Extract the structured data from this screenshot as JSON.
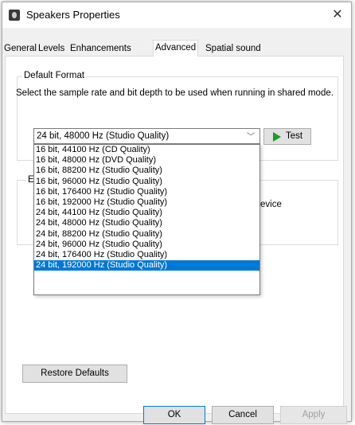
{
  "window": {
    "title": "Speakers Properties",
    "close_glyph": "✕"
  },
  "tabs": [
    {
      "label": "General"
    },
    {
      "label": "Levels"
    },
    {
      "label": "Enhancements"
    },
    {
      "label": "Advanced"
    },
    {
      "label": "Spatial sound"
    }
  ],
  "active_tab": "Advanced",
  "default_format": {
    "group_title": "Default Format",
    "description": "Select the sample rate and bit depth to be used when running in shared mode.",
    "selected_value": "24 bit, 48000 Hz (Studio Quality)",
    "test_label": "Test",
    "options": [
      "16 bit, 44100 Hz (CD Quality)",
      "16 bit, 48000 Hz (DVD Quality)",
      "16 bit, 88200 Hz (Studio Quality)",
      "16 bit, 96000 Hz (Studio Quality)",
      "16 bit, 176400 Hz (Studio Quality)",
      "16 bit, 192000 Hz (Studio Quality)",
      "24 bit, 44100 Hz (Studio Quality)",
      "24 bit, 48000 Hz (Studio Quality)",
      "24 bit, 88200 Hz (Studio Quality)",
      "24 bit, 96000 Hz (Studio Quality)",
      "24 bit, 176400 Hz (Studio Quality)",
      "24 bit, 192000 Hz (Studio Quality)"
    ],
    "highlighted_option": "24 bit, 192000 Hz (Studio Quality)"
  },
  "exclusive_mode": {
    "group_title_partial": "E",
    "text_partial": "evice"
  },
  "buttons": {
    "restore_defaults": "Restore Defaults",
    "ok": "OK",
    "cancel": "Cancel",
    "apply": "Apply"
  },
  "colors": {
    "selection": "#0078d7",
    "test_play": "#1e9a2a"
  },
  "icons": {
    "window": "speaker-icon",
    "test": "play-triangle-icon",
    "dropdown": "chevron-down-icon"
  }
}
